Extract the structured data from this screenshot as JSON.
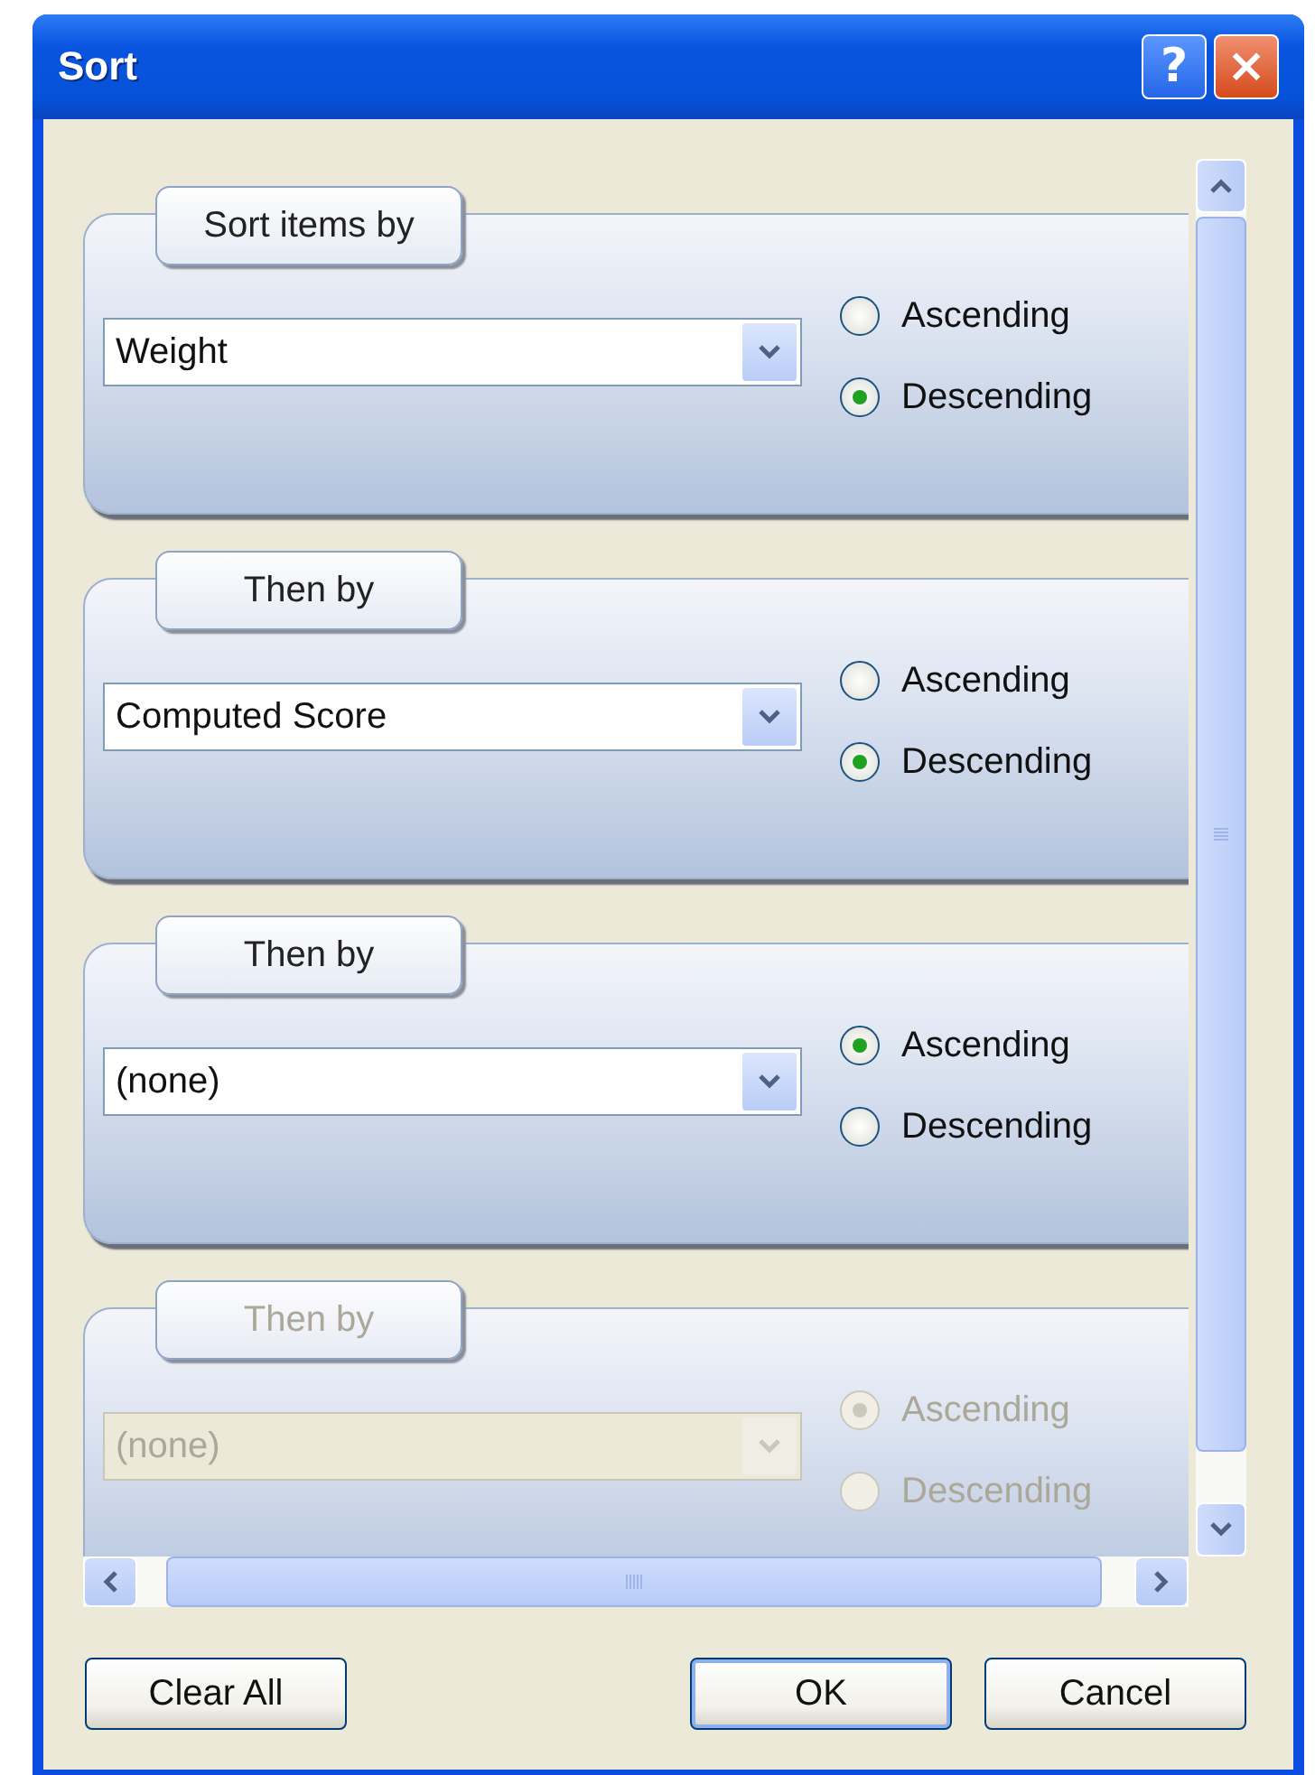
{
  "window": {
    "title": "Sort",
    "help_button": "?",
    "close_button": "×"
  },
  "groups": [
    {
      "label": "Sort items by",
      "value": "Weight",
      "disabled": false,
      "options": [
        {
          "label": "Ascending",
          "selected": false
        },
        {
          "label": "Descending",
          "selected": true
        }
      ]
    },
    {
      "label": "Then by",
      "value": "Computed Score",
      "disabled": false,
      "options": [
        {
          "label": "Ascending",
          "selected": false
        },
        {
          "label": "Descending",
          "selected": true
        }
      ]
    },
    {
      "label": "Then by",
      "value": "(none)",
      "disabled": false,
      "options": [
        {
          "label": "Ascending",
          "selected": true
        },
        {
          "label": "Descending",
          "selected": false
        }
      ]
    },
    {
      "label": "Then by",
      "value": "(none)",
      "disabled": true,
      "options": [
        {
          "label": "Ascending",
          "selected": true
        },
        {
          "label": "Descending",
          "selected": false
        }
      ]
    }
  ],
  "buttons": [
    {
      "label": "Clear All",
      "kind": "left"
    },
    {
      "label": "OK",
      "kind": "default"
    },
    {
      "label": "Cancel",
      "kind": "normal"
    }
  ]
}
